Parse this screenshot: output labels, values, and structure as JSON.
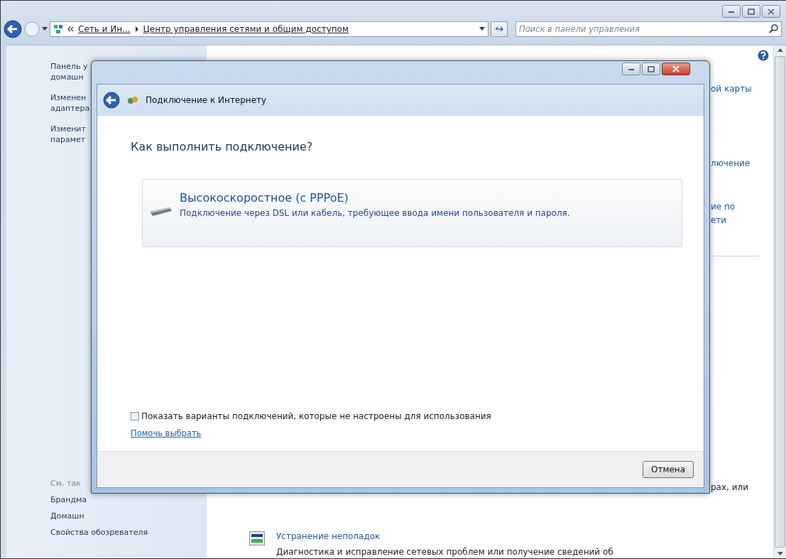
{
  "window": {
    "breadcrumb": [
      "Сеть и Ин...",
      "Центр управления сетями и общим доступом"
    ],
    "search": {
      "placeholder": "Поиск в панели управления"
    }
  },
  "sidebar": {
    "links": [
      "Панель у\nдомашн",
      "Изменен\nадаптера",
      "Изменит\nпарамет"
    ],
    "see_also": {
      "heading": "См. так",
      "links": [
        "Брандма",
        "Домашн",
        "Свойства обозревателя"
      ]
    }
  },
  "main": {
    "fragments": [
      "ой карты",
      "лючение",
      "ие по\nети",
      "рах, или"
    ],
    "troubleshoot": {
      "title": "Устранение неполадок",
      "description": "Диагностика и исправление сетевых проблем или получение сведений об"
    }
  },
  "dialog": {
    "title": "Подключение к Интернету",
    "heading": "Как выполнить подключение?",
    "options": [
      {
        "title": "Высокоскоростное (с PPPoE)",
        "description": "Подключение через DSL или кабель, требующее ввода имени пользователя и пароля."
      }
    ],
    "show_all": {
      "label": "Показать варианты подключений, которые не настроены для использования",
      "checked": false
    },
    "help_link": "Помочь выбрать",
    "buttons": [
      "Отмена"
    ]
  }
}
